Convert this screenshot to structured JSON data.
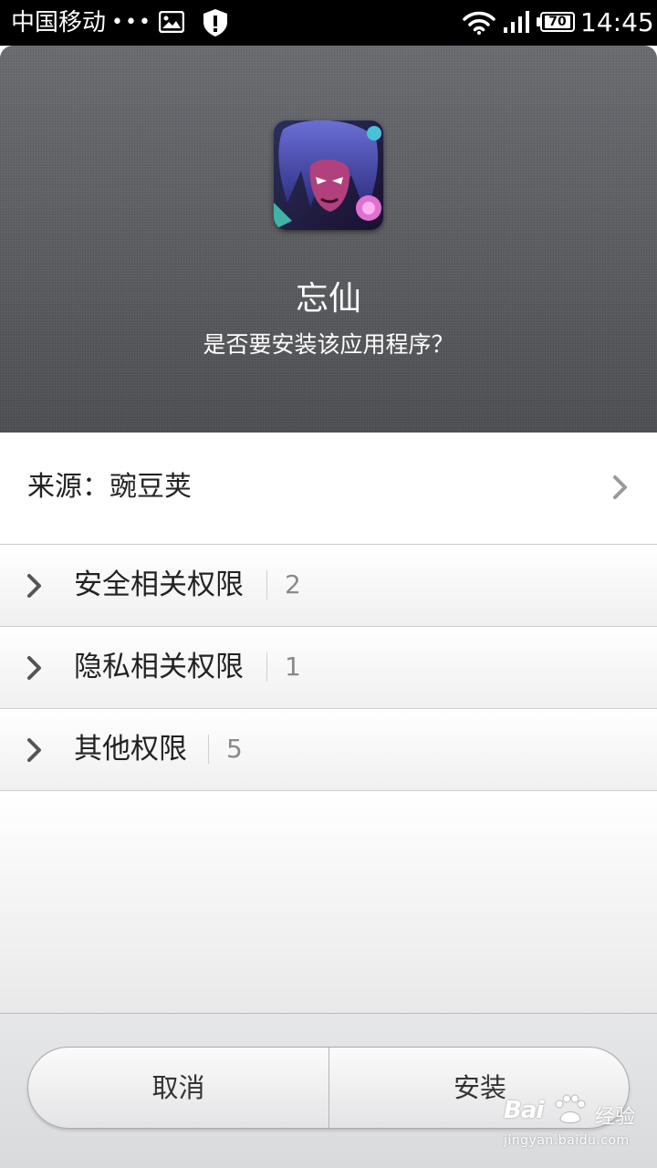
{
  "status_bar": {
    "carrier": "中国移动",
    "dots": "•••",
    "battery": "70",
    "time": "14:45"
  },
  "header": {
    "app_name": "忘仙",
    "question": "是否要安装该应用程序？"
  },
  "source": {
    "label": "来源：豌豆荚"
  },
  "permissions": [
    {
      "label": "安全相关权限",
      "count": "2"
    },
    {
      "label": "隐私相关权限",
      "count": "1"
    },
    {
      "label": "其他权限",
      "count": "5"
    }
  ],
  "buttons": {
    "cancel": "取消",
    "install": "安装"
  },
  "watermark": {
    "brand": "Bai",
    "brand_suffix": "经验",
    "url": "jingyan.baidu.com"
  },
  "colors": {
    "header_bg": "#55565a",
    "status_bar_bg": "#000000"
  }
}
